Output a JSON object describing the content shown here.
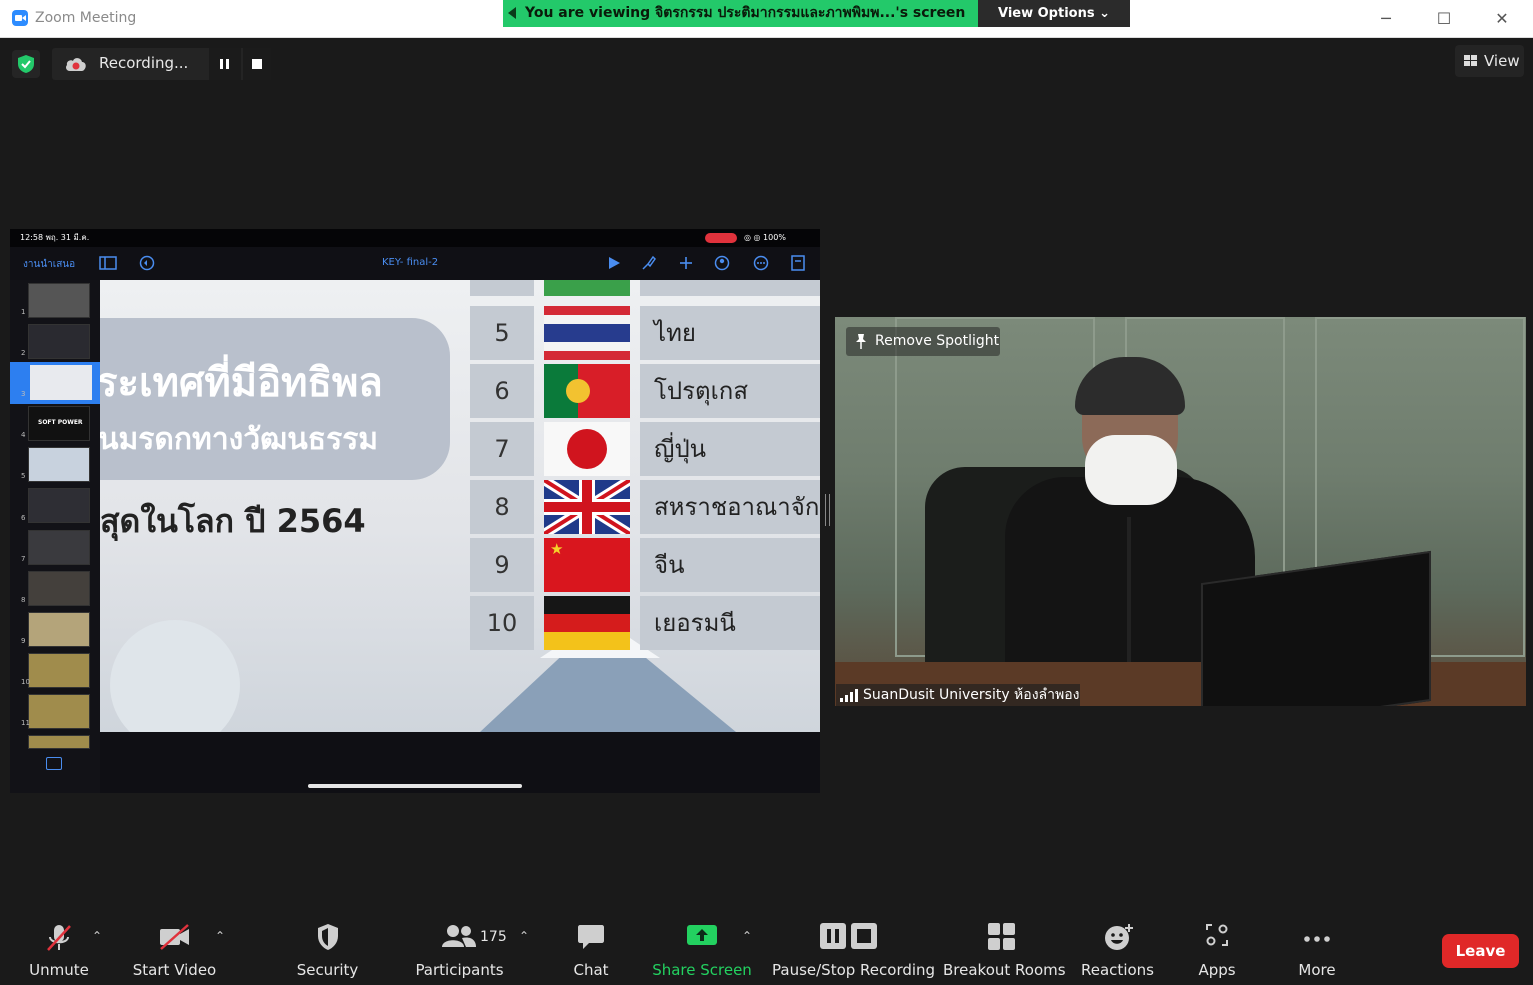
{
  "window": {
    "title": "Zoom Meeting",
    "minimize": "─",
    "maximize": "☐",
    "close": "✕"
  },
  "share_banner": {
    "text": "You are viewing จิตรกรรม ประติมากรรมและภาพพิมพ...'s screen",
    "view_options": "View Options ⌄"
  },
  "recording": {
    "label": "Recording..."
  },
  "view_button": {
    "label": "View"
  },
  "shared_screen": {
    "status_time": "12:58  พฤ. 31 มี.ค.",
    "status_right": "◎ ◎ 100%",
    "presentation_label": "งานนำเสนอ",
    "doc_title": "KEY- final-2",
    "thumb_numbers": [
      "1",
      "2",
      "3",
      "4",
      "5",
      "6",
      "7",
      "8",
      "9",
      "10",
      "11"
    ],
    "thumb_text_4": "SOFT POWER",
    "slide_line1": "ระเทศที่มีอิทธิพล",
    "slide_line2": "นมรดกทางวัฒนธรรม",
    "slide_line3": "สุดในโลก ปี 2564",
    "rows": [
      {
        "rank": "5",
        "country": "ไทย"
      },
      {
        "rank": "6",
        "country": "โปรตุเกส"
      },
      {
        "rank": "7",
        "country": "ญี่ปุ่น"
      },
      {
        "rank": "8",
        "country": "สหราชอาณาจักร"
      },
      {
        "rank": "9",
        "country": "จีน"
      },
      {
        "rank": "10",
        "country": "เยอรมนี"
      }
    ]
  },
  "video": {
    "remove_spotlight": "Remove Spotlight",
    "name": "SuanDusit University ห้องลำพอง"
  },
  "toolbar": {
    "unmute": "Unmute",
    "start_video": "Start Video",
    "security": "Security",
    "participants": "Participants",
    "participants_count": "175",
    "chat": "Chat",
    "share_screen": "Share Screen",
    "pause_stop_recording": "Pause/Stop Recording",
    "breakout_rooms": "Breakout Rooms",
    "reactions": "Reactions",
    "apps": "Apps",
    "more": "More",
    "leave": "Leave",
    "caret": "⌃"
  },
  "colors": {
    "banner_green": "#23c96a",
    "share_green": "#23d160",
    "leave_red": "#e02828",
    "ipad_blue": "#4a8df0"
  }
}
